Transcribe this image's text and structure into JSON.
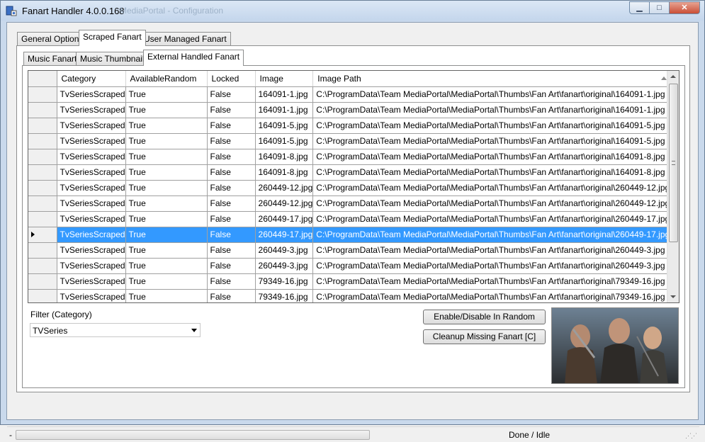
{
  "window": {
    "title": "Fanart Handler 4.0.0.168",
    "background_title": "MediaPortal - Configuration",
    "controls": {
      "minimize": "▁",
      "maximize": "□",
      "close": "✕"
    }
  },
  "main_tabs": [
    {
      "label": "General Options"
    },
    {
      "label": "Scraped Fanart"
    },
    {
      "label": "User Managed Fanart"
    }
  ],
  "sub_tabs": [
    {
      "label": "Music Fanart"
    },
    {
      "label": "Music Thumbnails"
    },
    {
      "label": "External Handled Fanart"
    }
  ],
  "grid": {
    "columns": [
      "Category",
      "AvailableRandom",
      "Locked",
      "Image",
      "Image Path"
    ],
    "sorted_column": "Image Path",
    "selected_row": 9,
    "rows": [
      [
        "TvSeriesScraped",
        "True",
        "False",
        "164091-1.jpg",
        "C:\\ProgramData\\Team MediaPortal\\MediaPortal\\Thumbs\\Fan Art\\fanart\\original\\164091-1.jpg"
      ],
      [
        "TvSeriesScraped",
        "True",
        "False",
        "164091-1.jpg",
        "C:\\ProgramData\\Team MediaPortal\\MediaPortal\\Thumbs\\Fan Art\\fanart\\original\\164091-1.jpg"
      ],
      [
        "TvSeriesScraped",
        "True",
        "False",
        "164091-5.jpg",
        "C:\\ProgramData\\Team MediaPortal\\MediaPortal\\Thumbs\\Fan Art\\fanart\\original\\164091-5.jpg"
      ],
      [
        "TvSeriesScraped",
        "True",
        "False",
        "164091-5.jpg",
        "C:\\ProgramData\\Team MediaPortal\\MediaPortal\\Thumbs\\Fan Art\\fanart\\original\\164091-5.jpg"
      ],
      [
        "TvSeriesScraped",
        "True",
        "False",
        "164091-8.jpg",
        "C:\\ProgramData\\Team MediaPortal\\MediaPortal\\Thumbs\\Fan Art\\fanart\\original\\164091-8.jpg"
      ],
      [
        "TvSeriesScraped",
        "True",
        "False",
        "164091-8.jpg",
        "C:\\ProgramData\\Team MediaPortal\\MediaPortal\\Thumbs\\Fan Art\\fanart\\original\\164091-8.jpg"
      ],
      [
        "TvSeriesScraped",
        "True",
        "False",
        "260449-12.jpg",
        "C:\\ProgramData\\Team MediaPortal\\MediaPortal\\Thumbs\\Fan Art\\fanart\\original\\260449-12.jpg"
      ],
      [
        "TvSeriesScraped",
        "True",
        "False",
        "260449-12.jpg",
        "C:\\ProgramData\\Team MediaPortal\\MediaPortal\\Thumbs\\Fan Art\\fanart\\original\\260449-12.jpg"
      ],
      [
        "TvSeriesScraped",
        "True",
        "False",
        "260449-17.jpg",
        "C:\\ProgramData\\Team MediaPortal\\MediaPortal\\Thumbs\\Fan Art\\fanart\\original\\260449-17.jpg"
      ],
      [
        "TvSeriesScraped",
        "True",
        "False",
        "260449-17.jpg",
        "C:\\ProgramData\\Team MediaPortal\\MediaPortal\\Thumbs\\Fan Art\\fanart\\original\\260449-17.jpg"
      ],
      [
        "TvSeriesScraped",
        "True",
        "False",
        "260449-3.jpg",
        "C:\\ProgramData\\Team MediaPortal\\MediaPortal\\Thumbs\\Fan Art\\fanart\\original\\260449-3.jpg"
      ],
      [
        "TvSeriesScraped",
        "True",
        "False",
        "260449-3.jpg",
        "C:\\ProgramData\\Team MediaPortal\\MediaPortal\\Thumbs\\Fan Art\\fanart\\original\\260449-3.jpg"
      ],
      [
        "TvSeriesScraped",
        "True",
        "False",
        "79349-16.jpg",
        "C:\\ProgramData\\Team MediaPortal\\MediaPortal\\Thumbs\\Fan Art\\fanart\\original\\79349-16.jpg"
      ],
      [
        "TvSeriesScraped",
        "True",
        "False",
        "79349-16.jpg",
        "C:\\ProgramData\\Team MediaPortal\\MediaPortal\\Thumbs\\Fan Art\\fanart\\original\\79349-16.jpg"
      ]
    ]
  },
  "filter": {
    "label": "Filter (Category)",
    "value": "TVSeries"
  },
  "buttons": {
    "toggle_random": "Enable/Disable In Random",
    "cleanup": "Cleanup Missing Fanart [C]"
  },
  "status": {
    "left": "-",
    "text": "Done / Idle",
    "progress": 0
  },
  "colors": {
    "selection": "#3399ff",
    "title_gradient_top": "#dbe7f5",
    "close_button": "#c94e36"
  }
}
